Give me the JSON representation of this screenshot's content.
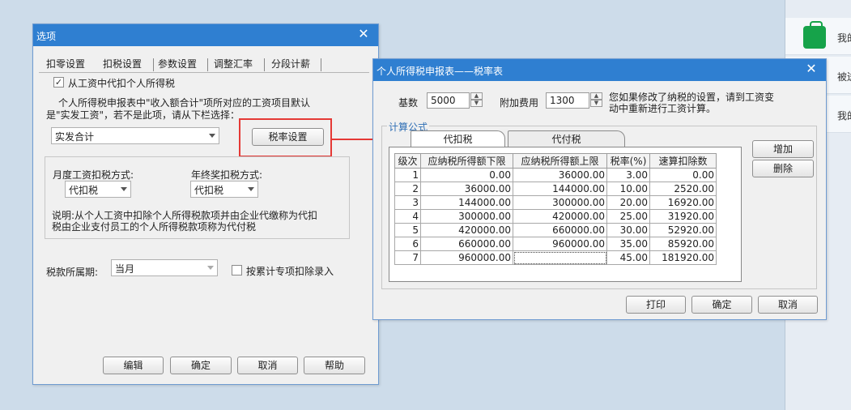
{
  "right_panel": {
    "items": [
      {
        "label": "我的"
      },
      {
        "label": "被送"
      },
      {
        "label": "我的"
      }
    ]
  },
  "options_dialog": {
    "title": "选项",
    "tabs": [
      "扣零设置",
      "扣税设置",
      "参数设置",
      "调整汇率",
      "分段计薪"
    ],
    "active_tab": "扣税设置",
    "withhold_checkbox": {
      "label": "从工资中代扣个人所得税",
      "checked": true
    },
    "desc_line1": "个人所得税申报表中\"收入额合计\"项所对应的工资项目默认",
    "desc_line2": "是\"实发工资\"，若不是此项，请从下栏选择：",
    "salary_item_select": "实发合计",
    "tax_rate_button": "税率设置",
    "monthly_method_label": "月度工资扣税方式:",
    "monthly_method_value": "代扣税",
    "annual_bonus_label": "年终奖扣税方式:",
    "annual_bonus_value": "代扣税",
    "note_line1": "说明:从个人工资中扣除个人所得税款项并由企业代缴称为代扣",
    "note_line2": "税由企业支付员工的个人所得税款项称为代付税",
    "tax_period_label": "税款所属期:",
    "tax_period_value": "当月",
    "cumulative_checkbox": {
      "label": "按累计专项扣除录入",
      "checked": false
    },
    "buttons": {
      "edit": "编辑",
      "ok": "确定",
      "cancel": "取消",
      "help": "帮助"
    }
  },
  "rate_dialog": {
    "title": "个人所得税申报表——税率表",
    "base_label": "基数",
    "base_value": "5000",
    "extra_label": "附加费用",
    "extra_value": "1300",
    "hint_line1": "您如果修改了纳税的设置，请到工资变",
    "hint_line2": "动中重新进行工资计算。",
    "formula_group": "计算公式",
    "tabs": [
      "代扣税",
      "代付税"
    ],
    "active_tab": "代扣税",
    "columns": [
      "级次",
      "应纳税所得额下限",
      "应纳税所得额上限",
      "税率(%)",
      "速算扣除数"
    ],
    "rows": [
      [
        "1",
        "0.00",
        "36000.00",
        "3.00",
        "0.00"
      ],
      [
        "2",
        "36000.00",
        "144000.00",
        "10.00",
        "2520.00"
      ],
      [
        "3",
        "144000.00",
        "300000.00",
        "20.00",
        "16920.00"
      ],
      [
        "4",
        "300000.00",
        "420000.00",
        "25.00",
        "31920.00"
      ],
      [
        "5",
        "420000.00",
        "660000.00",
        "30.00",
        "52920.00"
      ],
      [
        "6",
        "660000.00",
        "960000.00",
        "35.00",
        "85920.00"
      ],
      [
        "7",
        "960000.00",
        "",
        "45.00",
        "181920.00"
      ]
    ],
    "buttons": {
      "add": "增加",
      "delete": "删除",
      "print": "打印",
      "ok": "确定",
      "cancel": "取消"
    }
  },
  "colors": {
    "titlebar": "#2f7fd1",
    "highlight": "#e53935",
    "icon_green": "#16a34a"
  }
}
